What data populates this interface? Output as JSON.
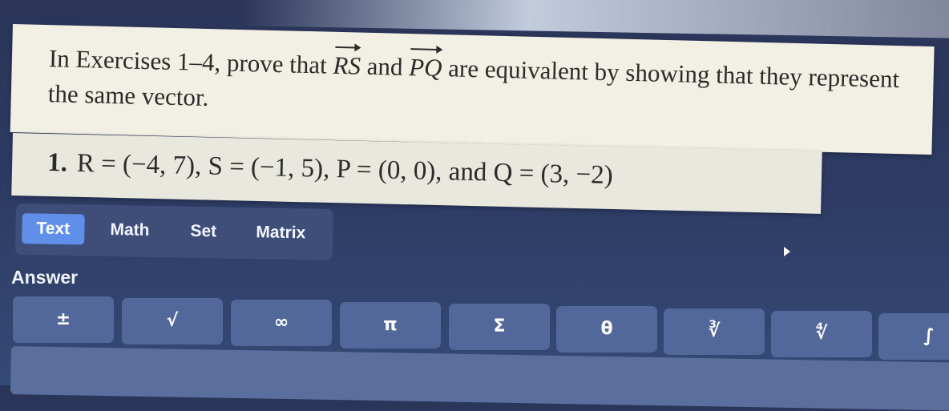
{
  "prompt": {
    "part1": "In Exercises 1–4, prove that ",
    "vec1": "RS",
    "part2": " and ",
    "vec2": "PQ",
    "part3": " are equivalent by showing that they represent the same vector."
  },
  "exercise": {
    "number": "1.",
    "text": "R = (−4, 7), S = (−1, 5), P = (0, 0), and Q = (3, −2)"
  },
  "tabs": [
    {
      "label": "Text",
      "active": true
    },
    {
      "label": "Math",
      "active": false
    },
    {
      "label": "Set",
      "active": false
    },
    {
      "label": "Matrix",
      "active": false
    }
  ],
  "answer_label": "Answer",
  "toolbar": [
    "±",
    "√",
    "∞",
    "π",
    "Σ",
    "θ",
    "∛",
    "∜",
    "∫"
  ],
  "colors": {
    "active_tab": "#5f8fe8",
    "button": "#53689a",
    "background": "#2d3a62"
  }
}
